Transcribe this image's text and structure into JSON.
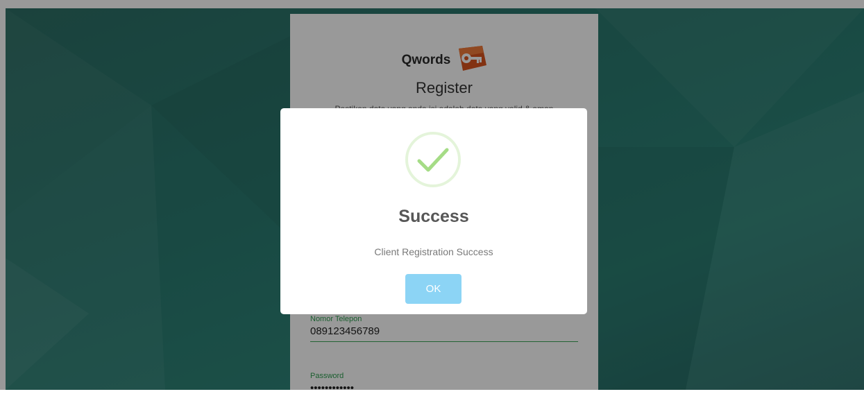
{
  "brand": {
    "name": "Qwords",
    "logo_icon": "key-icon"
  },
  "register": {
    "title": "Register",
    "subtitle": "Pastikan data yang anda isi adalah data yang valid & aman"
  },
  "fields": {
    "phone": {
      "label": "Nomor Telepon",
      "value": "089123456789"
    },
    "password": {
      "label": "Password",
      "value": "••••••••••••"
    }
  },
  "modal": {
    "icon": "checkmark-icon",
    "title": "Success",
    "message": "Client Registration Success",
    "ok_label": "OK"
  },
  "colors": {
    "background": "#2a7a70",
    "accent_green": "#3aa655",
    "success_check": "#a5dc86",
    "ok_button": "#8cd4f5"
  }
}
